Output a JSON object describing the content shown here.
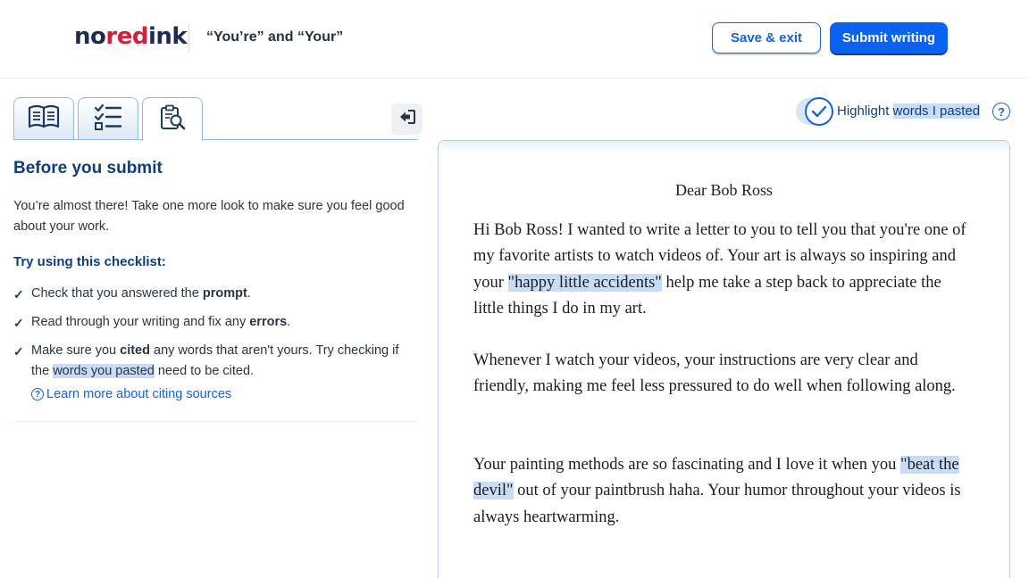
{
  "header": {
    "logo": {
      "part1": "no",
      "part2": "red",
      "part3": "ink"
    },
    "assignment_title": "“You’re” and “Your”",
    "save_exit_label": "Save & exit",
    "submit_label": "Submit writing"
  },
  "tabs": [
    {
      "icon": "book-icon"
    },
    {
      "icon": "checklist-icon"
    },
    {
      "icon": "clipboard-search-icon"
    }
  ],
  "collapse_icon": "collapse-panel-icon",
  "panel": {
    "heading": "Before you submit",
    "intro": "You’re almost there! Take one more look to make sure you feel good about your work.",
    "checklist_heading": "Try using this checklist:",
    "items": [
      {
        "before": "Check that you answered the ",
        "bold": "prompt",
        "after": "."
      },
      {
        "before": "Read through your writing and fix any ",
        "bold": "errors",
        "after": "."
      },
      {
        "before": "Make sure you ",
        "bold": "cited",
        "mid": " any words that aren't yours. Try checking if the ",
        "highlight": "words you pasted",
        "after": " need to be cited."
      }
    ],
    "learn_more_label": "Learn more about citing sources"
  },
  "highlight_toggle": {
    "label_plain": "Highlight ",
    "label_highlighted": "words I pasted",
    "checked": true
  },
  "editor": {
    "title": "Dear Bob Ross",
    "paragraphs": [
      {
        "before": "Hi Bob Ross! I wanted to write a letter to you to tell you that you're one of my favorite artists to watch videos of. Your art is always so inspiring and your ",
        "pasted": "\"happy little accidents\"",
        "after": " help me take a step back to appreciate the little things I do in my art."
      },
      {
        "text": "Whenever I watch your videos, your instructions are very clear and friendly, making me feel less pressured to do well when following along."
      },
      {
        "before": "Your painting methods are so fascinating and I love it when you ",
        "pasted": "\"beat the devil\"",
        "after": " out of your paintbrush haha. Your humor throughout your videos is always heartwarming."
      }
    ]
  },
  "colors": {
    "brand_red": "#d21f3c",
    "brand_navy": "#1e2b55",
    "primary_blue": "#0a63f0",
    "highlight": "#c9dcf5"
  }
}
